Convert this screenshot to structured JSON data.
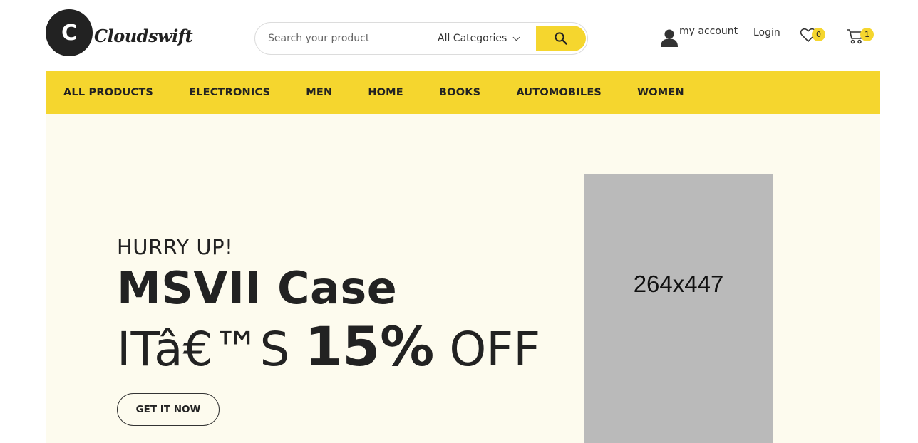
{
  "header": {
    "logo_letter": "C",
    "logo_text": "Cloudswift",
    "search": {
      "placeholder": "Search your product",
      "category_selected": "All Categories"
    },
    "account_label": "my account",
    "login_label": "Login",
    "wishlist_count": "0",
    "cart_count": "1"
  },
  "nav": {
    "items": [
      "ALL PRODUCTS",
      "ELECTRONICS",
      "MEN",
      "HOME",
      "BOOKS",
      "AUTOMOBILES",
      "WOMEN"
    ]
  },
  "hero": {
    "eyebrow": "HURRY UP!",
    "title": "MSVII Case",
    "offer_prefix": "ITâ€™S",
    "offer_percent": "15%",
    "offer_suffix": "OFF",
    "cta_label": "GET IT NOW",
    "image_placeholder": "264x447"
  },
  "colors": {
    "accent": "#f5d62e",
    "hero_background": "#fdfbee",
    "text": "#222222",
    "placeholder": "#bababa"
  },
  "icons": [
    "search-icon",
    "user-icon",
    "heart-icon",
    "cart-icon",
    "chevron-down-icon"
  ]
}
